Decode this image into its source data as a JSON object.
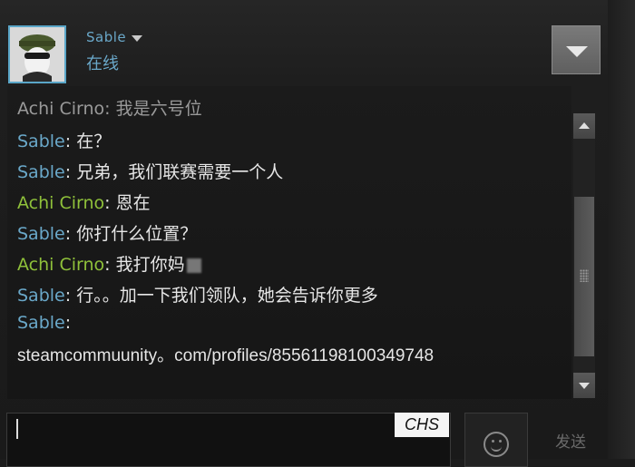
{
  "header": {
    "username": "Sable",
    "status": "在线"
  },
  "messages": [
    {
      "sender": "Achi Cirno",
      "text": "我是六号位",
      "kind": "achi"
    },
    {
      "sender": "Sable",
      "text": "在？",
      "kind": "sable"
    },
    {
      "sender": "Sable",
      "text": "兄弟，我们联赛需要一个人",
      "kind": "sable"
    },
    {
      "sender": "Achi Cirno",
      "text": "恩在",
      "kind": "achi"
    },
    {
      "sender": "Sable",
      "text": "你打什么位置？",
      "kind": "sable"
    },
    {
      "sender": "Achi Cirno",
      "text": "我打你妈",
      "kind": "achi"
    },
    {
      "sender": "Sable",
      "text": "行。。加一下我们领队，她会告诉你更多",
      "kind": "sable"
    },
    {
      "sender": "Sable",
      "text": "",
      "kind": "sable"
    }
  ],
  "link_text": "steamcommuunity。com/profiles/85561198100349748",
  "input": {
    "value": "",
    "ime_label": "CHS"
  },
  "send_label": "发送",
  "colors": {
    "sable": "#6aa8c9",
    "achi": "#8fc13a",
    "background": "#1c1c1c"
  },
  "icons": {
    "status_caret": "chevron-down-icon",
    "menu": "dropdown-arrow-icon",
    "emoji": "smiley-icon"
  }
}
